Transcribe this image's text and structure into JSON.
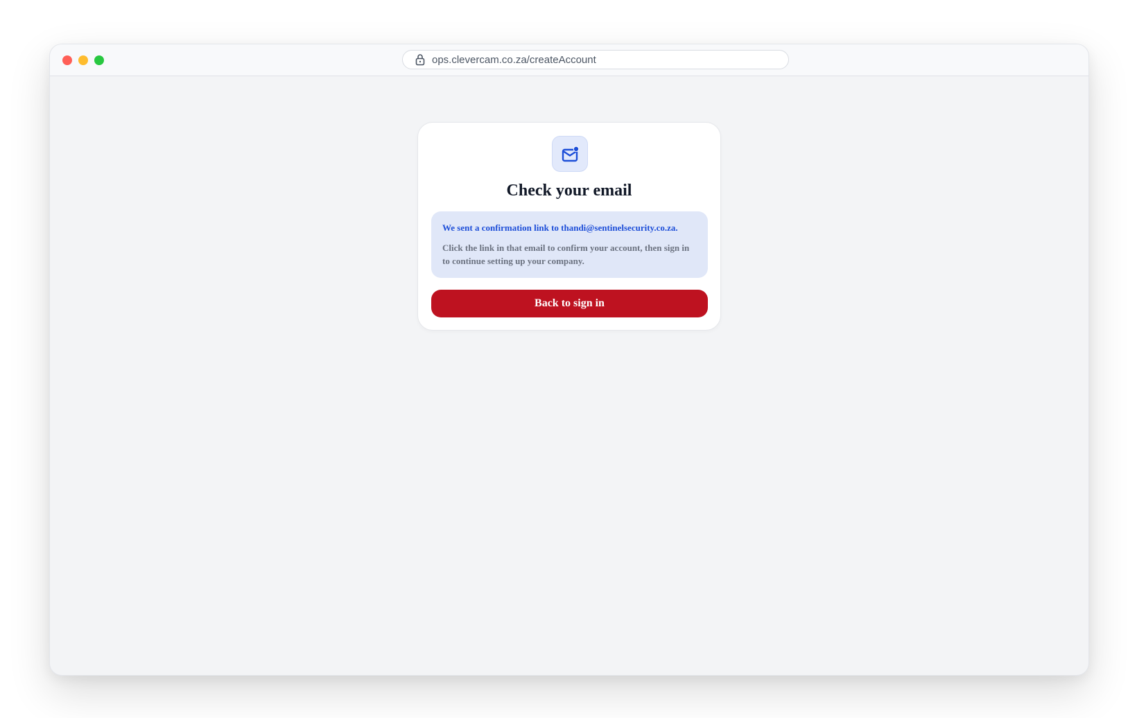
{
  "browser": {
    "url": "ops.clevercam.co.za/createAccount",
    "icons": {
      "close": "close-dot",
      "minimize": "minimize-dot",
      "maximize": "maximize-dot",
      "lock": "lock-icon"
    },
    "colors": {
      "close": "#ff5f57",
      "minimize": "#febc2e",
      "maximize": "#28c840"
    }
  },
  "card": {
    "icon": "mail-notification-icon",
    "title": "Check your email",
    "message_primary": "We sent a confirmation link to thandi@sentinelsecurity.co.za.",
    "message_secondary": "Click the link in that email to confirm your account, then sign in to continue setting up your company.",
    "button_label": "Back to sign in",
    "colors": {
      "accent_blue": "#1d4ed8",
      "info_background": "#e0e7f8",
      "button": "#be1220"
    }
  }
}
